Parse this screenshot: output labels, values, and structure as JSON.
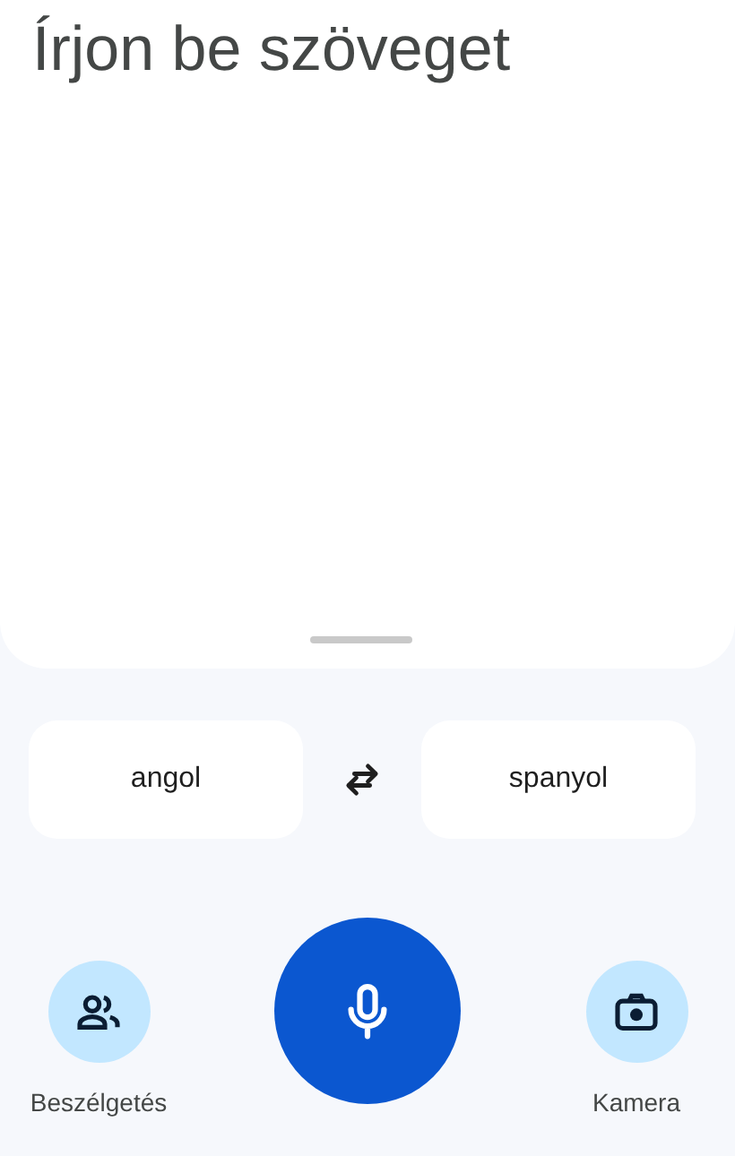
{
  "input": {
    "placeholder": "Írjon be szöveget"
  },
  "languages": [
    {
      "label": "angol"
    },
    {
      "label": "spanyol"
    }
  ],
  "actions": [
    {
      "kind": "conversation",
      "label": "Beszélgetés"
    },
    {
      "kind": "mic"
    },
    {
      "kind": "camera",
      "label": "Kamera"
    }
  ]
}
